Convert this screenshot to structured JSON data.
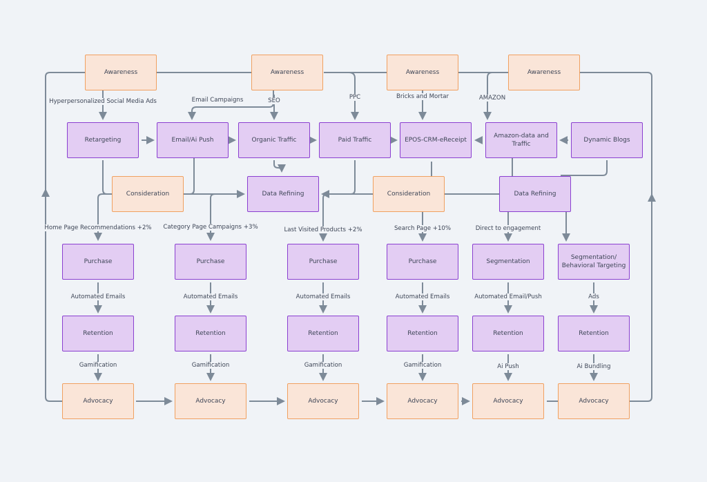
{
  "colors": {
    "awareness_fill": "#fae5d8",
    "awareness_border": "#f0a060",
    "process_fill": "#e3cdf3",
    "process_border": "#8a3fd0",
    "connector": "#7d8a98",
    "background": "#f0f3f7"
  },
  "nodes": {
    "awareness": [
      "Awareness",
      "Awareness",
      "Awareness",
      "Awareness"
    ],
    "channels": [
      "Retargeting",
      "Email/Ai Push",
      "Organic Traffic",
      "Paid Traffic",
      "EPOS-CRM-eReceipt",
      "Amazon-data and Traffic",
      "Dynamic Blogs"
    ],
    "middle": [
      "Consideration",
      "Data Refining",
      "Consideration",
      "Data Refining"
    ],
    "row4": [
      "Purchase",
      "Purchase",
      "Purchase",
      "Purchase",
      "Segmentation",
      "Segmentation/ Behavioral Targeting"
    ],
    "retention": [
      "Retention",
      "Retention",
      "Retention",
      "Retention",
      "Retention",
      "Retention"
    ],
    "advocacy": [
      "Advocacy",
      "Advocacy",
      "Advocacy",
      "Advocacy",
      "Advocacy",
      "Advocacy"
    ]
  },
  "edge_labels": {
    "top": [
      "Hyperpersonalized Social Media Ads",
      "Email Campaigns",
      "SEO",
      "PPC",
      "Bricks and Mortar",
      "AMAZON"
    ],
    "row4": [
      "Home Page Recommendations +2%",
      "Category Page Campaigns +3%",
      "Last Visited Products +2%",
      "Search Page +10%",
      "Direct to engagement"
    ],
    "row5": [
      "Automated Emails",
      "Automated Emails",
      "Automated Emails",
      "Automated Emails",
      "Automated Email/Push",
      "Ads"
    ],
    "row6": [
      "Gamification",
      "Gamification",
      "Gamification",
      "Gamification",
      "Ai Push",
      "Ai Bundling"
    ]
  }
}
